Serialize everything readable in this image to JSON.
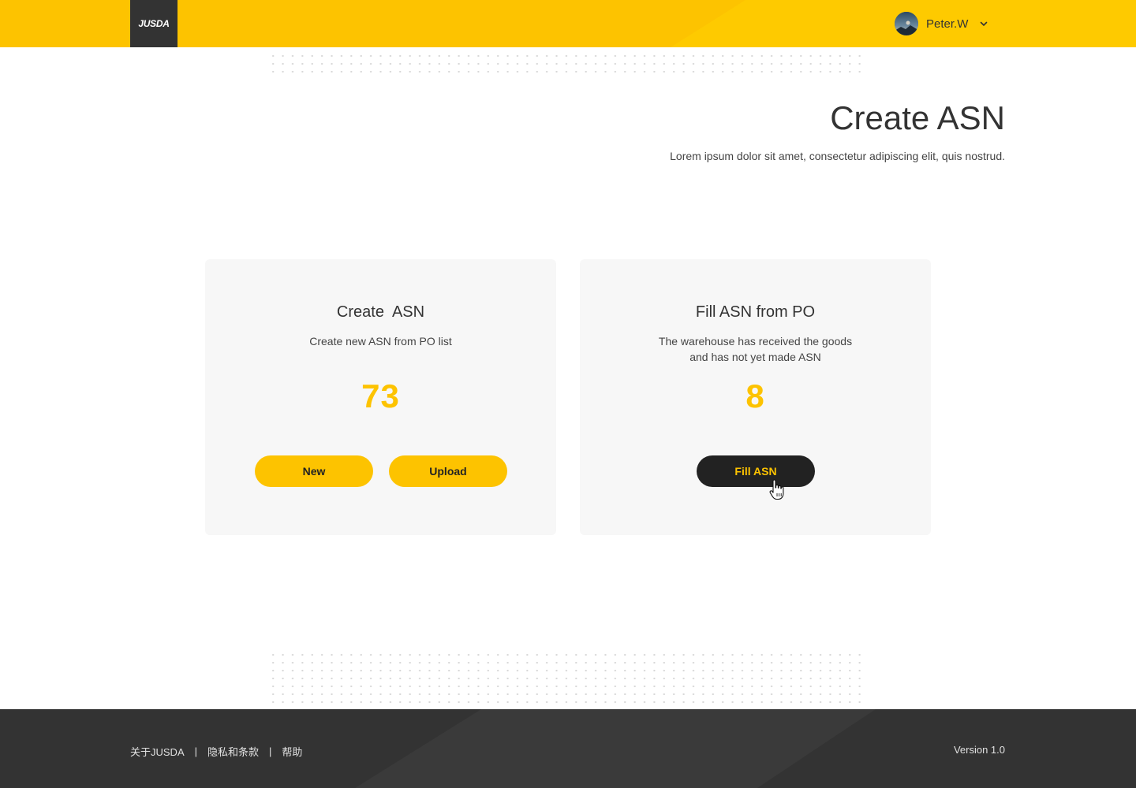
{
  "header": {
    "logo_text": "JUSDA",
    "user": {
      "name": "Peter.W"
    }
  },
  "hero": {
    "title": "Create ASN",
    "subtitle": "Lorem ipsum dolor sit amet, consectetur adipiscing elit, quis nostrud."
  },
  "cards": [
    {
      "title": "Create  ASN",
      "description": "Create new ASN from PO list",
      "count": "73",
      "buttons": [
        {
          "label": "New"
        },
        {
          "label": "Upload"
        }
      ]
    },
    {
      "title": "Fill ASN from PO",
      "description_line1": "The warehouse has received the goods",
      "description_line2": "and has not yet made ASN",
      "count": "8",
      "buttons": [
        {
          "label": "Fill ASN"
        }
      ]
    }
  ],
  "footer": {
    "links": [
      {
        "label": "关于JUSDA"
      },
      {
        "label": "隐私和条款"
      },
      {
        "label": "帮助"
      }
    ],
    "separator": "|",
    "version": "Version 1.0"
  },
  "colors": {
    "brand_yellow": "#fdc300",
    "dark": "#333333",
    "card_bg": "#f7f7f7"
  },
  "icons": {
    "user_menu": "chevron-down-icon",
    "cursor": "hand-pointer-icon"
  }
}
